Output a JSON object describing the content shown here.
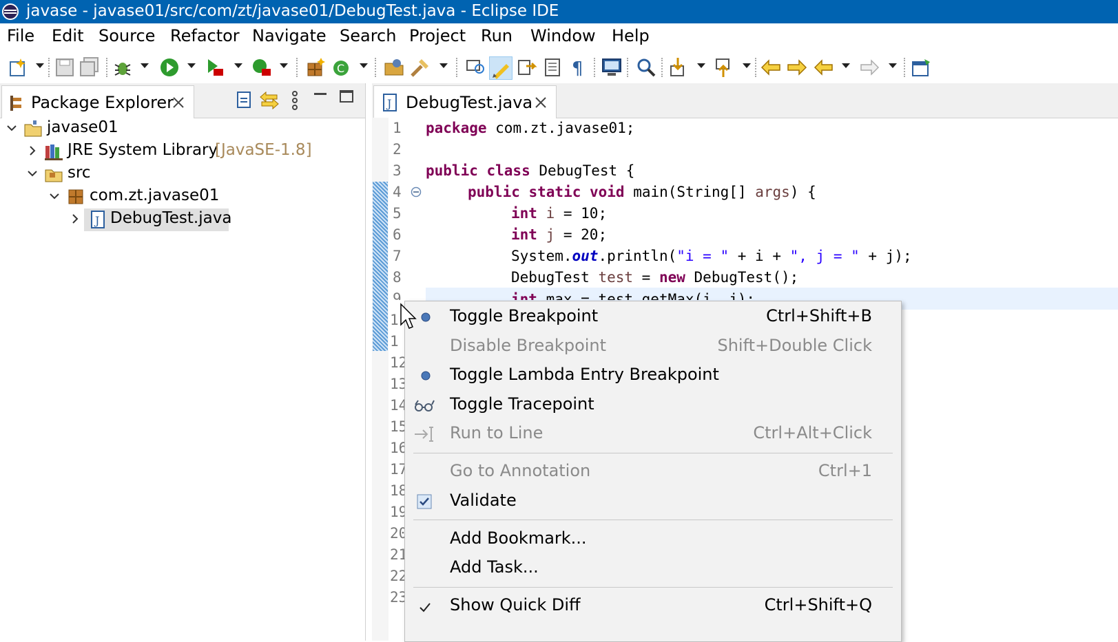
{
  "window": {
    "title": "javase - javase01/src/com/zt/javase01/DebugTest.java - Eclipse IDE"
  },
  "menubar": [
    "File",
    "Edit",
    "Source",
    "Refactor",
    "Navigate",
    "Search",
    "Project",
    "Run",
    "Window",
    "Help"
  ],
  "package_explorer": {
    "tab_label": "Package Explorer",
    "tree": {
      "project": "javase01",
      "jre_label": "JRE System Library",
      "jre_version": "[JavaSE-1.8]",
      "src": "src",
      "package": "com.zt.javase01",
      "file": "DebugTest.java"
    }
  },
  "editor": {
    "tab_label": "DebugTest.java",
    "line_numbers": [
      "1",
      "2",
      "3",
      "4",
      "5",
      "6",
      "7",
      "8",
      "9",
      "1",
      "1",
      "12",
      "13",
      "14",
      "15",
      "16",
      "17",
      "18",
      "19",
      "20",
      "21",
      "22",
      "23"
    ],
    "code": {
      "l1_kw": "package",
      "l1_rest": " com.zt.javase01;",
      "l3_kw": "public class",
      "l3_rest": " DebugTest {",
      "l4_kw": "public static void",
      "l4_rest": " main(String[] ",
      "l4_var": "args",
      "l4_end": ") {",
      "l5_kw": "int",
      "l5_var": " i",
      "l5_rest": " = 10;",
      "l6_kw": "int",
      "l6_var": " j",
      "l6_rest": " = 20;",
      "l7_a": "System.",
      "l7_fld": "out",
      "l7_b": ".println(",
      "l7_s1": "\"i = \"",
      "l7_c": " + i + ",
      "l7_s2": "\", j = \"",
      "l7_d": " + j);",
      "l8_a": "DebugTest ",
      "l8_var": "test",
      "l8_b": " = ",
      "l8_kw": "new",
      "l8_c": " DebugTest();",
      "l9_kw": "int",
      "l9_rest": " max = test.getMax(i, j);"
    }
  },
  "context_menu": [
    {
      "label": "Toggle Breakpoint",
      "shortcut": "Ctrl+Shift+B",
      "enabled": true,
      "icon": "breakpoint-icon"
    },
    {
      "label": "Disable Breakpoint",
      "shortcut": "Shift+Double Click",
      "enabled": false
    },
    {
      "label": "Toggle Lambda Entry Breakpoint",
      "shortcut": "",
      "enabled": true,
      "icon": "breakpoint-icon"
    },
    {
      "label": "Toggle Tracepoint",
      "shortcut": "",
      "enabled": true,
      "icon": "tracepoint-icon"
    },
    {
      "label": "Run to Line",
      "shortcut": "Ctrl+Alt+Click",
      "enabled": false,
      "icon": "run-to-line-icon"
    },
    {
      "label": "Go to Annotation",
      "shortcut": "Ctrl+1",
      "enabled": false
    },
    {
      "label": "Validate",
      "shortcut": "",
      "enabled": true,
      "icon": "validate-checkbox-icon"
    },
    {
      "label": "Add Bookmark...",
      "shortcut": "",
      "enabled": true
    },
    {
      "label": "Add Task...",
      "shortcut": "",
      "enabled": true
    },
    {
      "label": "Show Quick Diff",
      "shortcut": "Ctrl+Shift+Q",
      "enabled": true,
      "icon": "checkmark-icon"
    }
  ],
  "colors": {
    "titlebar": "#0063b1",
    "keyword": "#7f0055",
    "string": "#2a00ff",
    "field": "#0000c0"
  }
}
